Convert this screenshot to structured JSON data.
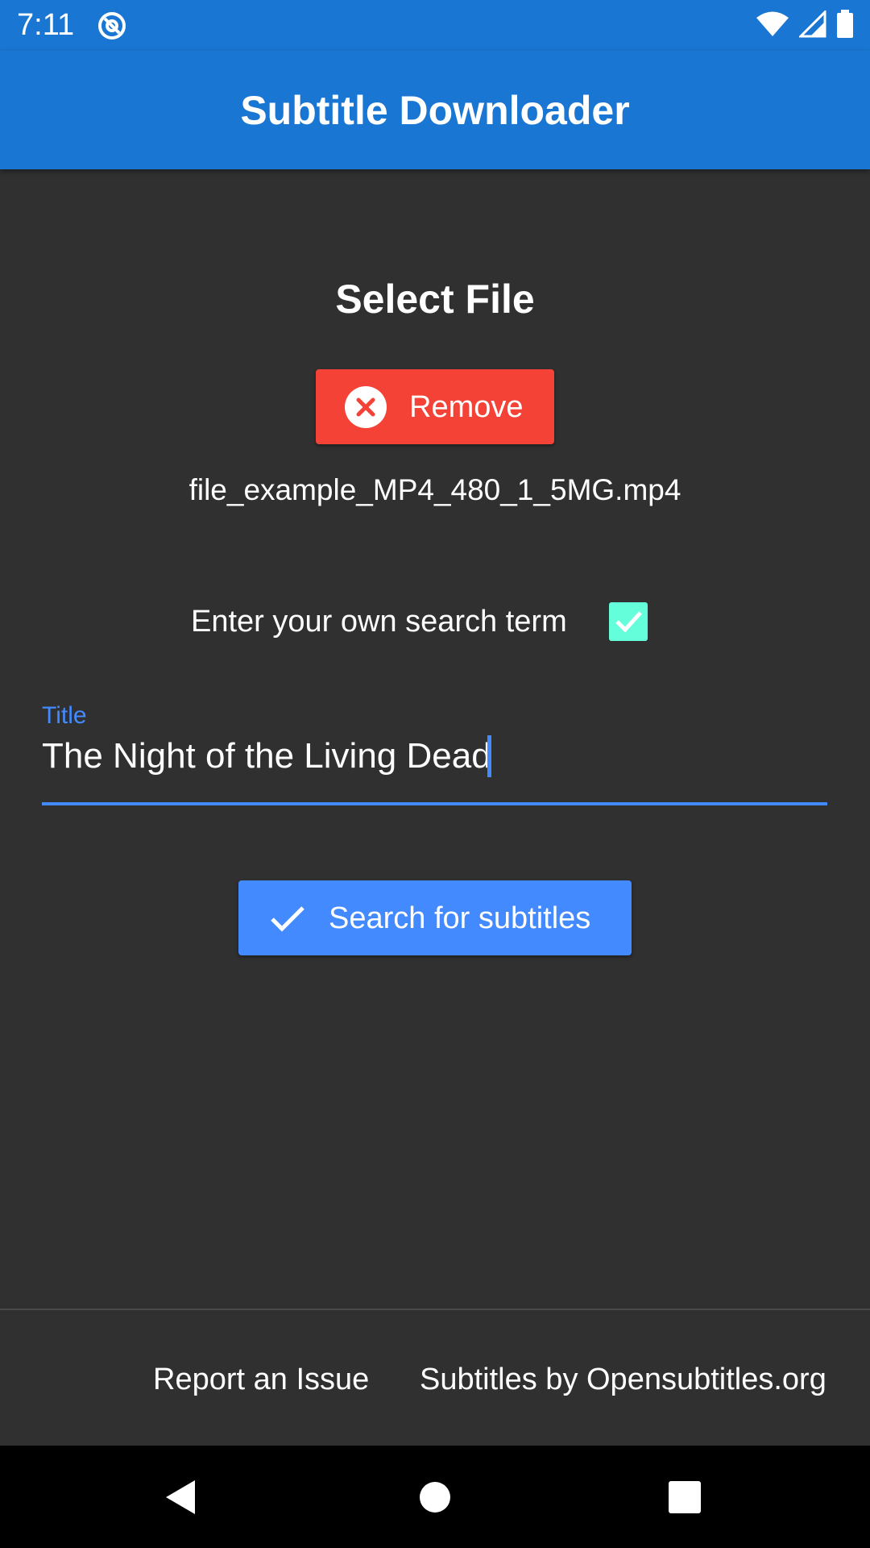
{
  "status_bar": {
    "time": "7:11",
    "left_icon": "at-sign-icon",
    "right_icons": [
      "wifi-icon",
      "cellular-signal-icon",
      "battery-icon"
    ]
  },
  "app_bar": {
    "title": "Subtitle Downloader",
    "color": "#1976D2"
  },
  "main": {
    "section_title": "Select File",
    "remove_button": {
      "label": "Remove",
      "icon": "close-circle-icon",
      "color": "#F44336"
    },
    "file_name": "file_example_MP4_480_1_5MG.mp4",
    "own_search_term": {
      "label": "Enter your own search term",
      "checked": true,
      "checkbox_color": "#64FFDA"
    },
    "title_field": {
      "label": "Title",
      "value": "The Night of the Living Dead",
      "accent_color": "#448AFF"
    },
    "search_button": {
      "label": "Search for subtitles",
      "icon": "check-icon",
      "color": "#448AFF"
    }
  },
  "footer": {
    "report_link": "Report an Issue",
    "credits_link": "Subtitles by Opensubtitles.org"
  },
  "nav_bar": {
    "buttons": [
      "back-icon",
      "home-icon",
      "recents-icon"
    ]
  }
}
